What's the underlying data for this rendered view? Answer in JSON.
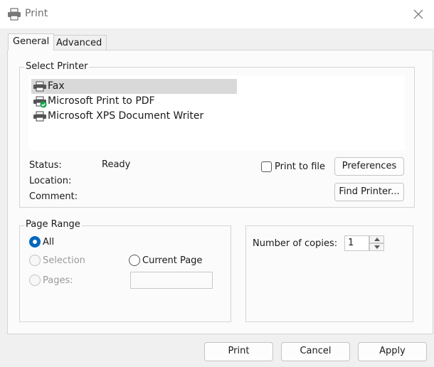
{
  "window": {
    "title": "Print"
  },
  "tabs": [
    {
      "label": "General",
      "active": true
    },
    {
      "label": "Advanced",
      "active": false
    }
  ],
  "select_printer": {
    "group_label": "Select Printer",
    "printers": [
      {
        "name": "Fax",
        "selected": true,
        "icon": "printer-icon"
      },
      {
        "name": "Microsoft Print to PDF",
        "selected": false,
        "icon": "printer-default-icon"
      },
      {
        "name": "Microsoft XPS Document Writer",
        "selected": false,
        "icon": "printer-icon"
      }
    ],
    "status_label": "Status:",
    "status_value": "Ready",
    "location_label": "Location:",
    "comment_label": "Comment:",
    "print_to_file_label": "Print to file",
    "preferences_label": "Preferences",
    "find_printer_label": "Find Printer..."
  },
  "page_range": {
    "group_label": "Page Range",
    "all_label": "All",
    "selection_label": "Selection",
    "current_page_label": "Current Page",
    "pages_label": "Pages:",
    "pages_value": ""
  },
  "copies": {
    "label": "Number of copies:",
    "value": "1"
  },
  "footer": {
    "print_label": "Print",
    "cancel_label": "Cancel",
    "apply_label": "Apply"
  },
  "colors": {
    "accent": "#0067c0",
    "default_badge": "#16a34a"
  }
}
